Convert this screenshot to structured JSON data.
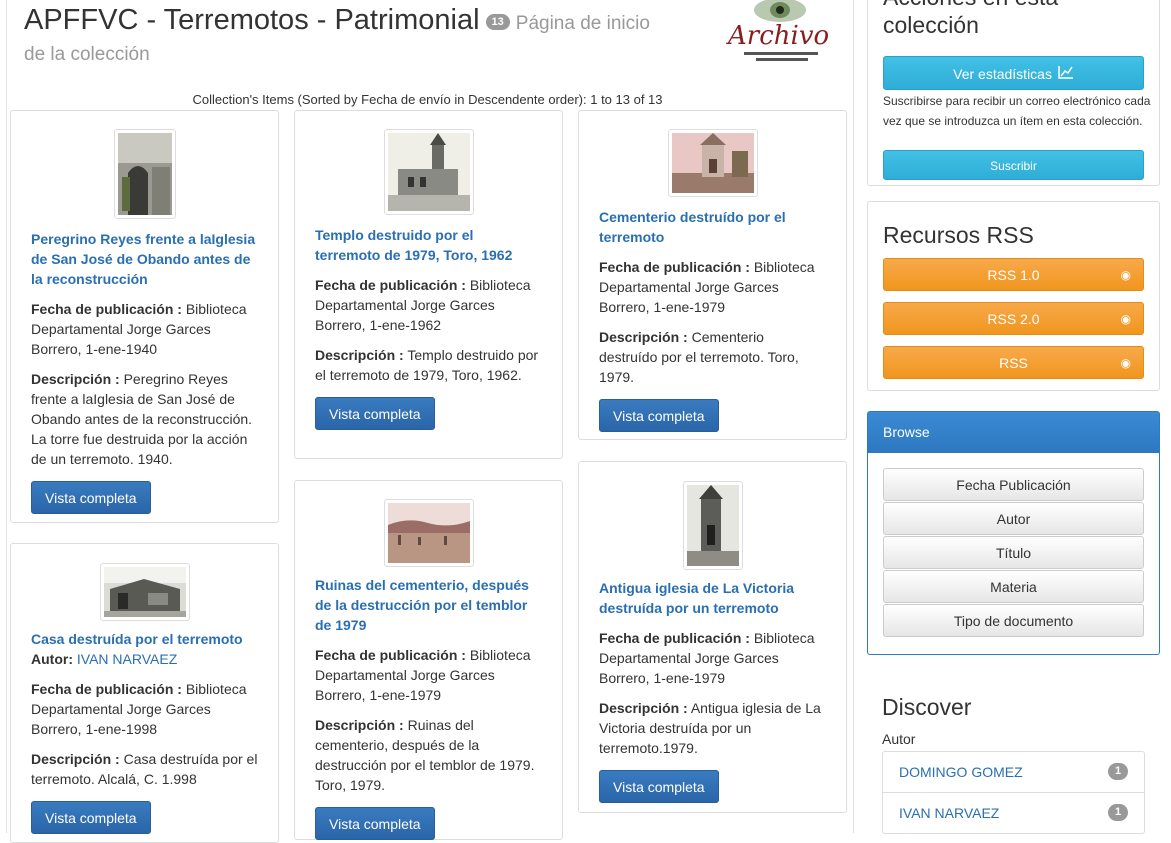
{
  "header": {
    "title": "APFFVC - Terremotos - Patrimonial",
    "count": "13",
    "subtitle_part1": "Página de inicio",
    "subtitle_part2": "de la colección",
    "logo_text": "Archivo"
  },
  "sort_info": "Collection's Items (Sorted by Fecha de envío in Descendente order): 1 to 13 of 13",
  "labels": {
    "fecha": "Fecha de publicación :",
    "descripcion": "Descripción :",
    "autor": "Autor:",
    "vista": "Vista completa"
  },
  "items": [
    {
      "title": "Peregrino Reyes frente a laIglesia de San José de Obando antes de la reconstrucción",
      "fecha": "Biblioteca Departamental Jorge Garces Borrero, 1-ene-1940",
      "descripcion": "Peregrino Reyes frente a laIglesia de San José de Obando antes de la reconstrucción. La torre fue destruida por la acción de un terremoto. 1940."
    },
    {
      "title": "Templo destruido por el terremoto de 1979, Toro, 1962",
      "fecha": "Biblioteca Departamental Jorge Garces Borrero, 1-ene-1962",
      "descripcion": "Templo destruido por el terremoto de 1979, Toro, 1962."
    },
    {
      "title": "Cementerio destruído por el terremoto",
      "fecha": "Biblioteca Departamental Jorge Garces Borrero, 1-ene-1979",
      "descripcion": "Cementerio destruído por el terremoto. Toro, 1979."
    },
    {
      "title": "Casa destruída por el terremoto",
      "autor": "IVAN NARVAEZ",
      "fecha": "Biblioteca Departamental Jorge Garces Borrero, 1-ene-1998",
      "descripcion": "Casa destruída por el terremoto. Alcalá, C. 1.998"
    },
    {
      "title": "Ruinas del cementerio, después de la destrucción por el temblor de 1979",
      "fecha": "Biblioteca Departamental Jorge Garces Borrero, 1-ene-1979",
      "descripcion": "Ruinas del cementerio, después de la destrucción por el temblor de 1979. Toro, 1979."
    },
    {
      "title": "Antigua iglesia de La Victoria destruída por un terremoto",
      "fecha": "Biblioteca Departamental Jorge Garces Borrero, 1-ene-1979",
      "descripcion": "Antigua iglesia de La Victoria destruída por un terremoto.1979."
    }
  ],
  "sidebar": {
    "actions_title": "Acciones en esta colección",
    "stats_button": "Ver estadísticas",
    "subscribe_text": "Suscribirse para recibir un correo electrónico cada vez que se introduzca un ítem en esta colección.",
    "subscribe_button": "Suscribir",
    "rss_title": "Recursos RSS",
    "rss_buttons": [
      "RSS 1.0",
      "RSS 2.0",
      "RSS"
    ],
    "browse_title": "Browse",
    "browse_buttons": [
      "Fecha Publicación",
      "Autor",
      "Título",
      "Materia",
      "Tipo de documento"
    ],
    "discover_title": "Discover",
    "discover_subtitle": "Autor",
    "discover_items": [
      {
        "label": "DOMINGO GOMEZ",
        "count": "1"
      },
      {
        "label": "IVAN NARVAEZ",
        "count": "1"
      }
    ]
  },
  "colors": {
    "link": "#2a6fb0",
    "primary": "#2d6cb0",
    "info": "#35b6de",
    "warning": "#f0961e"
  }
}
